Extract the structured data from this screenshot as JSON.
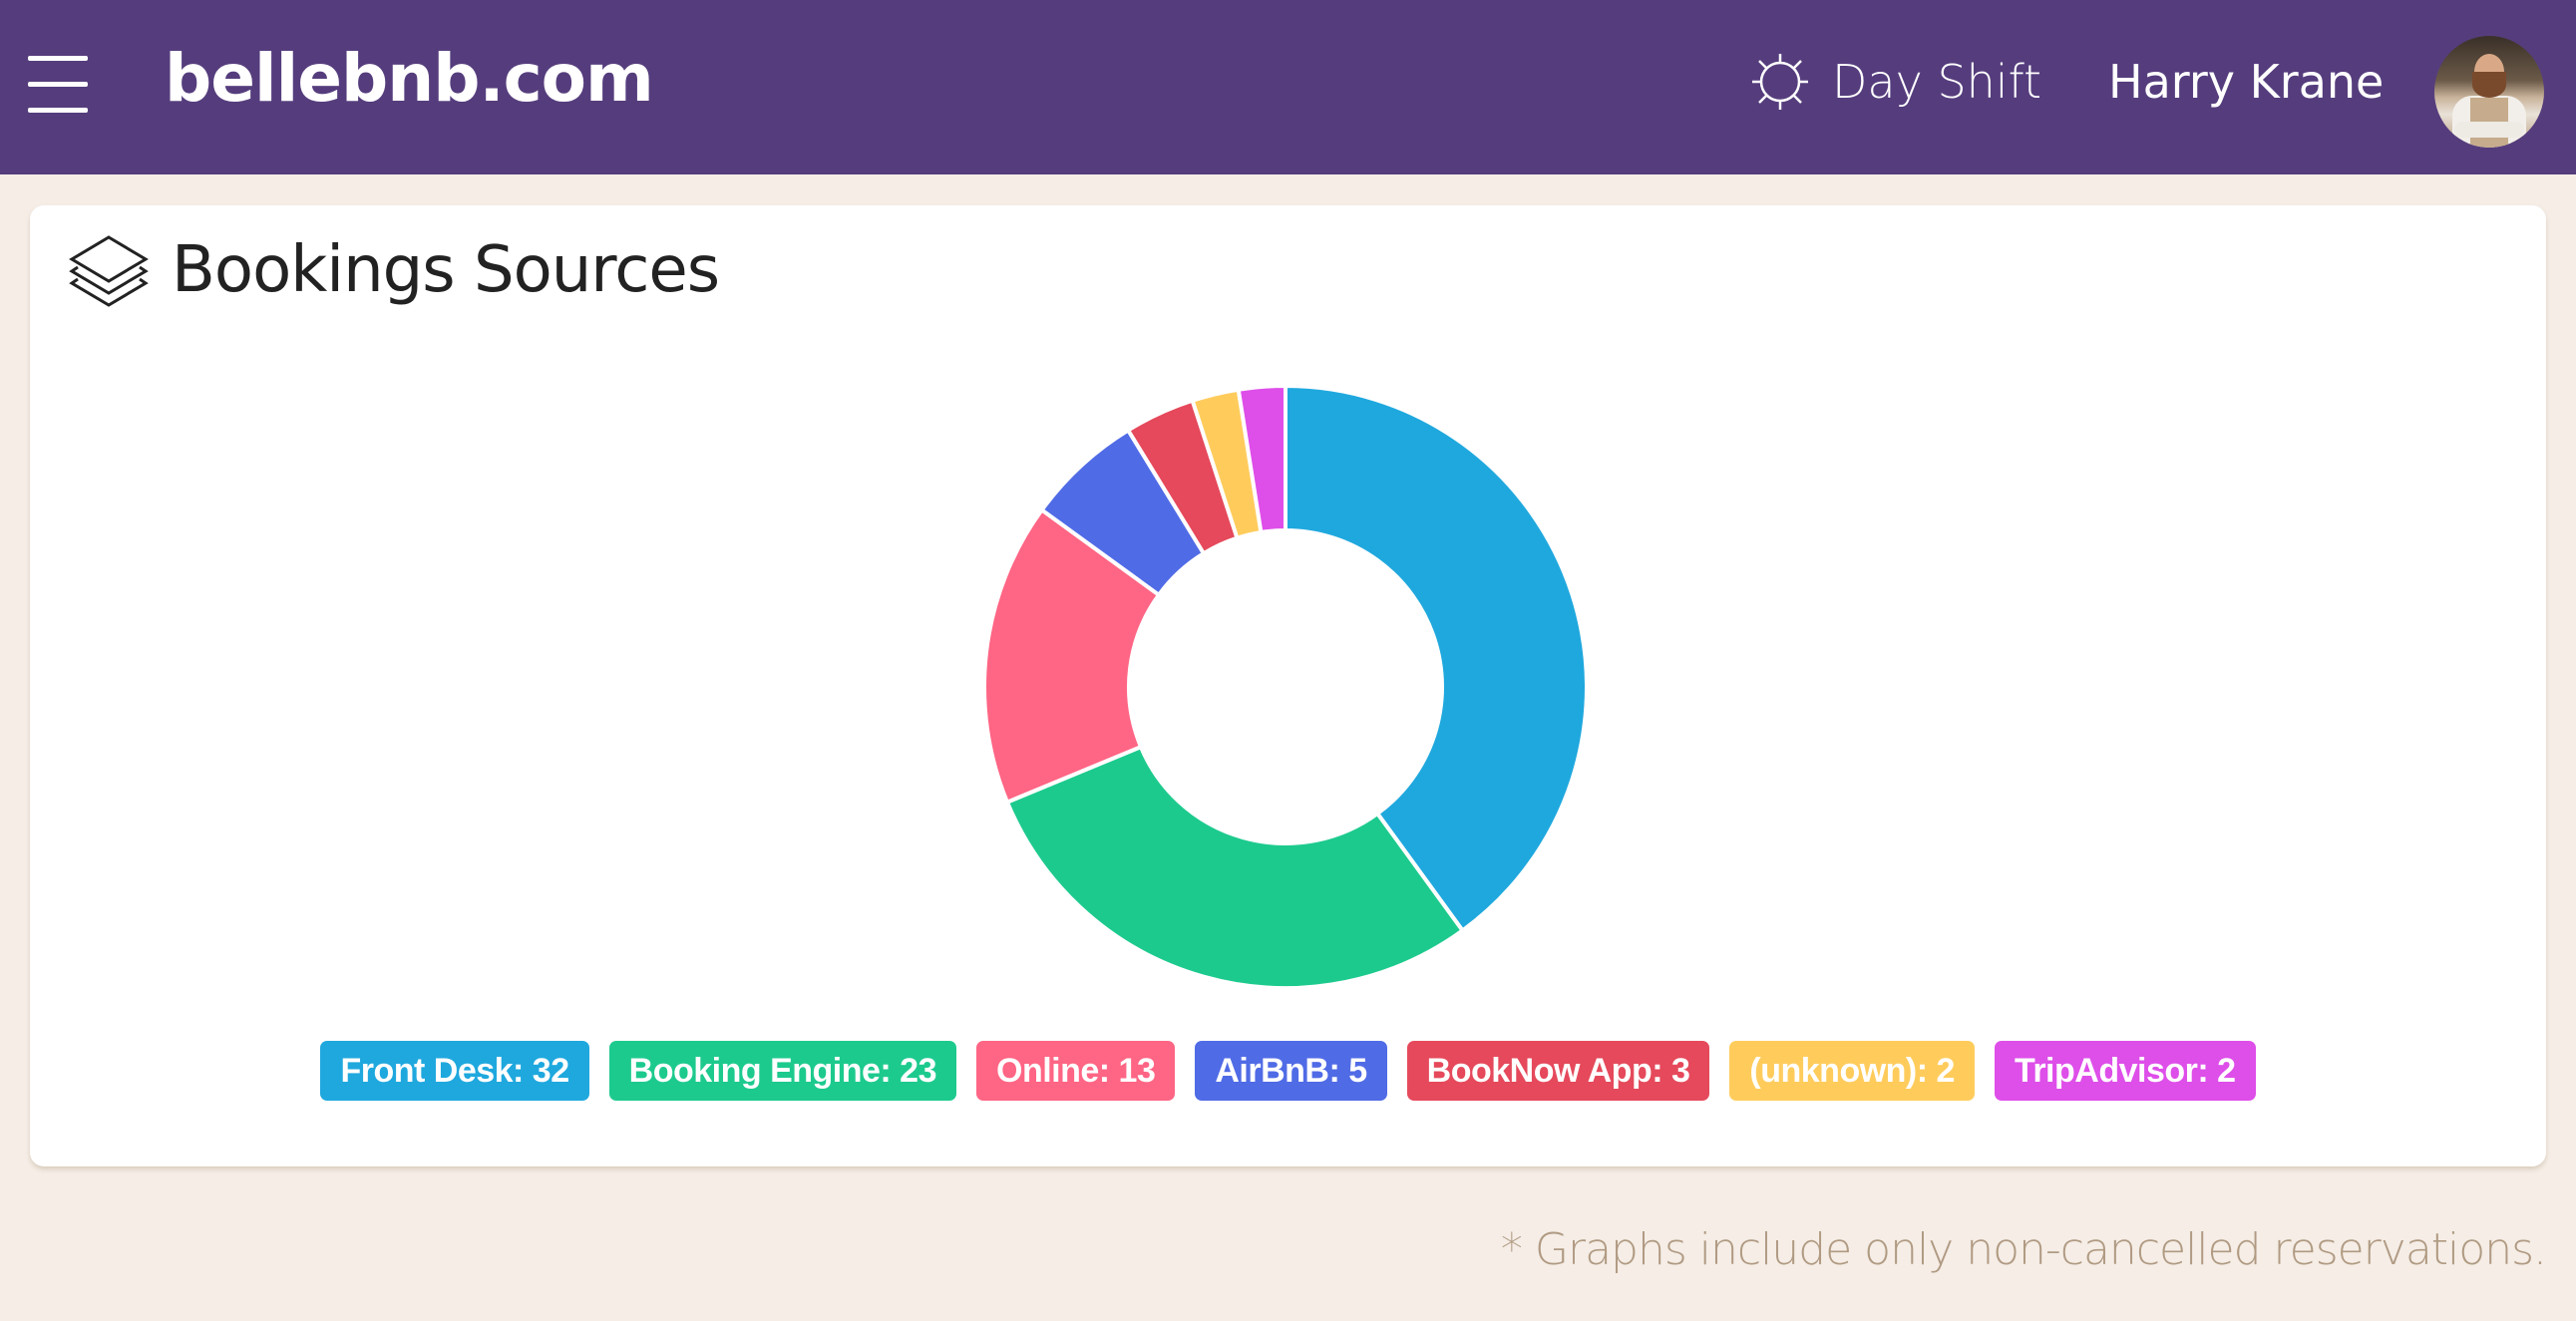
{
  "header": {
    "logo": "bellebnb.com",
    "shift_label": "Day Shift",
    "user_name": "Harry Krane",
    "background_color": "#553d7d"
  },
  "card": {
    "title": "Bookings Sources",
    "icon": "layers-icon"
  },
  "footnote": "* Graphs include only non-cancelled reservations.",
  "chart_data": {
    "type": "pie",
    "variant": "donut",
    "title": "Bookings Sources",
    "categories": [
      "Front Desk",
      "Booking Engine",
      "Online",
      "AirBnB",
      "BookNow App",
      "(unknown)",
      "TripAdvisor"
    ],
    "values": [
      32,
      23,
      13,
      5,
      3,
      2,
      2
    ],
    "colors": [
      "#1fa8de",
      "#1dca8e",
      "#ff6584",
      "#506be6",
      "#e5495b",
      "#ffcc5c",
      "#de4ee9"
    ],
    "legend": [
      {
        "label": "Front Desk: 32"
      },
      {
        "label": "Booking Engine: 23"
      },
      {
        "label": "Online: 13"
      },
      {
        "label": "AirBnB: 5"
      },
      {
        "label": "BookNow App: 3"
      },
      {
        "label": "(unknown): 2"
      },
      {
        "label": "TripAdvisor: 2"
      }
    ],
    "legend_position": "bottom",
    "start_angle": "top, clockwise"
  }
}
